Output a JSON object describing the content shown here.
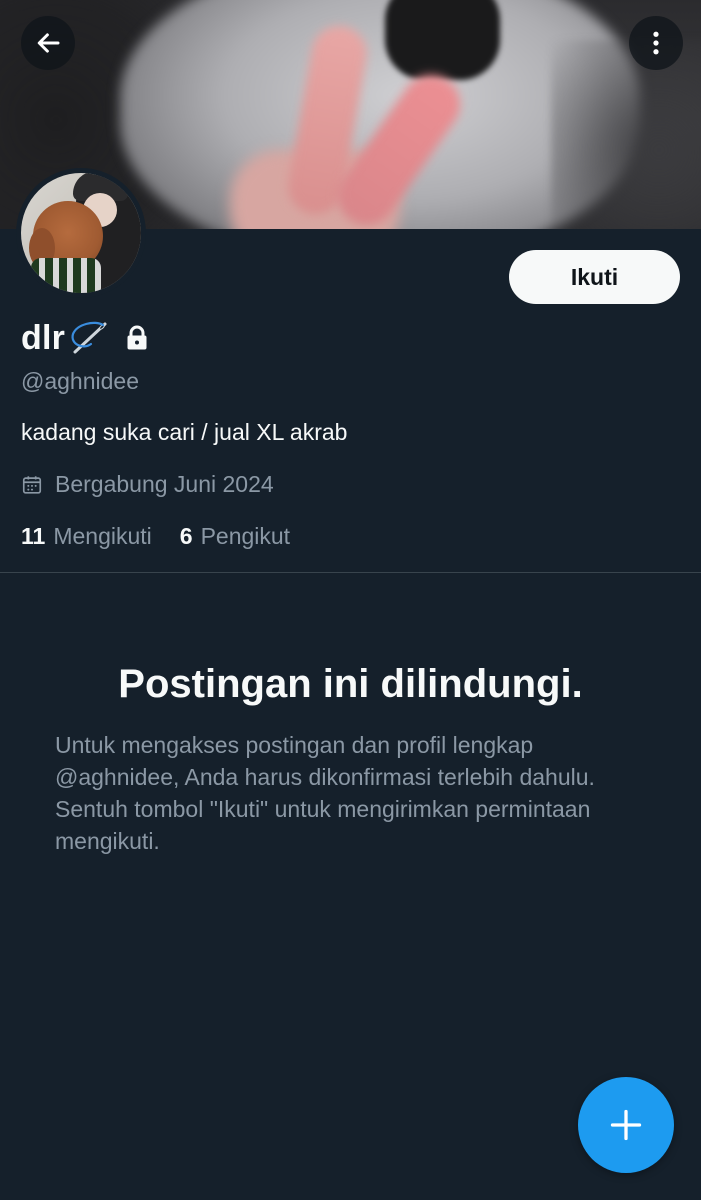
{
  "header": {
    "back_icon": "arrow-left-icon",
    "more_icon": "more-vertical-icon"
  },
  "profile": {
    "display_name": "dlr",
    "name_emoji_icon": "needle-thread-icon",
    "protected_icon": "lock-icon",
    "handle": "@aghnidee",
    "bio": "kadang suka cari / jual XL akrab",
    "joined_icon": "calendar-icon",
    "joined": "Bergabung Juni 2024",
    "following_count": "11",
    "following_label": "Mengikuti",
    "followers_count": "6",
    "followers_label": "Pengikut"
  },
  "follow_button": {
    "label": "Ikuti"
  },
  "protected": {
    "title": "Postingan ini dilindungi.",
    "body": "Untuk mengakses postingan dan profil lengkap @aghnidee, Anda harus dikonfirmasi terlebih dahulu. Sentuh tombol \"Ikuti\" untuk mengirimkan permintaan mengikuti."
  },
  "fab": {
    "icon": "plus-icon"
  },
  "colors": {
    "background": "#15202b",
    "text_primary": "#f7f9f9",
    "text_secondary": "#8b98a5",
    "divider": "#38444d",
    "accent": "#1d9bf0"
  }
}
